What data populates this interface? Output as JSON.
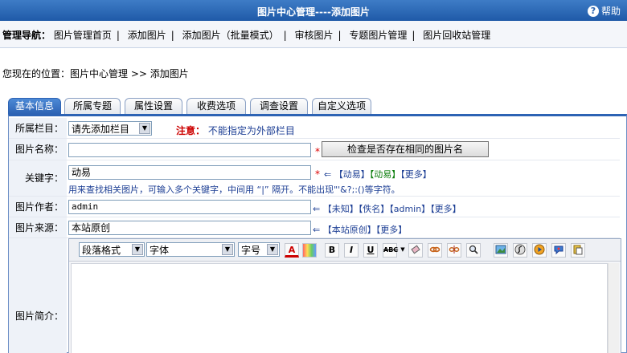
{
  "header": {
    "title": "图片中心管理----添加图片",
    "help_label": "帮助"
  },
  "nav": {
    "label": "管理导航：",
    "items": [
      "图片管理首页",
      "添加图片",
      "添加图片（批量模式）",
      "审核图片",
      "专题图片管理",
      "图片回收站管理"
    ]
  },
  "breadcrumb": "您现在的位置：图片中心管理 >> 添加图片",
  "tabs": [
    "基本信息",
    "所属专题",
    "属性设置",
    "收费选项",
    "调查设置",
    "自定义选项"
  ],
  "form": {
    "column": {
      "label": "所属栏目：",
      "selected": "请先添加栏目",
      "note_prefix": "注意：",
      "note": "不能指定为外部栏目"
    },
    "name": {
      "label": "图片名称：",
      "value": "",
      "required": "*",
      "check_button": "检查是否存在相同的图片名"
    },
    "keywords": {
      "label": "关键字：",
      "value": "动易",
      "required": "*",
      "suggest_arrow": "⇐",
      "suggestions": [
        "【动易】",
        "【动易】",
        "【更多】"
      ],
      "hint": "用来查找相关图片，可输入多个关键字，中间用 “|” 隔开。不能出现\"'&?;:()等字符。"
    },
    "author": {
      "label": "图片作者：",
      "value": "admin",
      "suggest_arrow": "⇐",
      "suggestions": [
        "【未知】",
        "【佚名】",
        "【admin】",
        "【更多】"
      ]
    },
    "source": {
      "label": "图片来源：",
      "value": "本站原创",
      "suggest_arrow": "⇐",
      "suggestions": [
        "【本站原创】",
        "【更多】"
      ]
    },
    "intro": {
      "label": "图片简介：",
      "toolbar": {
        "paragraph_format": "段落格式",
        "font": "字体",
        "font_size": "字号",
        "buttons": [
          "font-color-icon",
          "highlight-color-icon",
          "bold-icon",
          "italic-icon",
          "underline-icon",
          "strikethrough-icon",
          "dropdown-icon",
          "eraser-icon",
          "link-icon",
          "unlink-icon",
          "find-icon",
          "image-icon",
          "flash-icon",
          "media-icon",
          "emoticon-icon",
          "paste-icon"
        ],
        "bold_label": "B",
        "italic_label": "I",
        "underline_label": "U",
        "strike_label": "ABC",
        "font_color_label": "A"
      }
    }
  },
  "colors": {
    "header_bg": "#2a64b0",
    "required": "#dd0000",
    "link_blue": "#1c3e94",
    "note_red": "#cc0000"
  }
}
